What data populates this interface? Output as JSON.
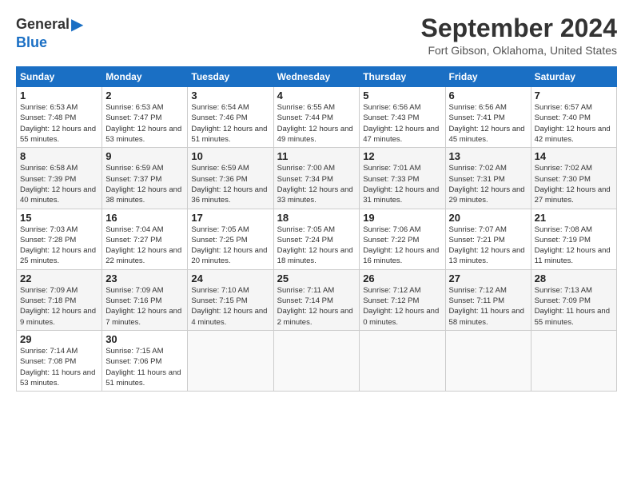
{
  "logo": {
    "general": "General",
    "blue": "Blue"
  },
  "title": "September 2024",
  "location": "Fort Gibson, Oklahoma, United States",
  "days_header": [
    "Sunday",
    "Monday",
    "Tuesday",
    "Wednesday",
    "Thursday",
    "Friday",
    "Saturday"
  ],
  "weeks": [
    [
      {
        "day": "1",
        "sunrise": "6:53 AM",
        "sunset": "7:48 PM",
        "daylight": "12 hours and 55 minutes."
      },
      {
        "day": "2",
        "sunrise": "6:53 AM",
        "sunset": "7:47 PM",
        "daylight": "12 hours and 53 minutes."
      },
      {
        "day": "3",
        "sunrise": "6:54 AM",
        "sunset": "7:46 PM",
        "daylight": "12 hours and 51 minutes."
      },
      {
        "day": "4",
        "sunrise": "6:55 AM",
        "sunset": "7:44 PM",
        "daylight": "12 hours and 49 minutes."
      },
      {
        "day": "5",
        "sunrise": "6:56 AM",
        "sunset": "7:43 PM",
        "daylight": "12 hours and 47 minutes."
      },
      {
        "day": "6",
        "sunrise": "6:56 AM",
        "sunset": "7:41 PM",
        "daylight": "12 hours and 45 minutes."
      },
      {
        "day": "7",
        "sunrise": "6:57 AM",
        "sunset": "7:40 PM",
        "daylight": "12 hours and 42 minutes."
      }
    ],
    [
      {
        "day": "8",
        "sunrise": "6:58 AM",
        "sunset": "7:39 PM",
        "daylight": "12 hours and 40 minutes."
      },
      {
        "day": "9",
        "sunrise": "6:59 AM",
        "sunset": "7:37 PM",
        "daylight": "12 hours and 38 minutes."
      },
      {
        "day": "10",
        "sunrise": "6:59 AM",
        "sunset": "7:36 PM",
        "daylight": "12 hours and 36 minutes."
      },
      {
        "day": "11",
        "sunrise": "7:00 AM",
        "sunset": "7:34 PM",
        "daylight": "12 hours and 33 minutes."
      },
      {
        "day": "12",
        "sunrise": "7:01 AM",
        "sunset": "7:33 PM",
        "daylight": "12 hours and 31 minutes."
      },
      {
        "day": "13",
        "sunrise": "7:02 AM",
        "sunset": "7:31 PM",
        "daylight": "12 hours and 29 minutes."
      },
      {
        "day": "14",
        "sunrise": "7:02 AM",
        "sunset": "7:30 PM",
        "daylight": "12 hours and 27 minutes."
      }
    ],
    [
      {
        "day": "15",
        "sunrise": "7:03 AM",
        "sunset": "7:28 PM",
        "daylight": "12 hours and 25 minutes."
      },
      {
        "day": "16",
        "sunrise": "7:04 AM",
        "sunset": "7:27 PM",
        "daylight": "12 hours and 22 minutes."
      },
      {
        "day": "17",
        "sunrise": "7:05 AM",
        "sunset": "7:25 PM",
        "daylight": "12 hours and 20 minutes."
      },
      {
        "day": "18",
        "sunrise": "7:05 AM",
        "sunset": "7:24 PM",
        "daylight": "12 hours and 18 minutes."
      },
      {
        "day": "19",
        "sunrise": "7:06 AM",
        "sunset": "7:22 PM",
        "daylight": "12 hours and 16 minutes."
      },
      {
        "day": "20",
        "sunrise": "7:07 AM",
        "sunset": "7:21 PM",
        "daylight": "12 hours and 13 minutes."
      },
      {
        "day": "21",
        "sunrise": "7:08 AM",
        "sunset": "7:19 PM",
        "daylight": "12 hours and 11 minutes."
      }
    ],
    [
      {
        "day": "22",
        "sunrise": "7:09 AM",
        "sunset": "7:18 PM",
        "daylight": "12 hours and 9 minutes."
      },
      {
        "day": "23",
        "sunrise": "7:09 AM",
        "sunset": "7:16 PM",
        "daylight": "12 hours and 7 minutes."
      },
      {
        "day": "24",
        "sunrise": "7:10 AM",
        "sunset": "7:15 PM",
        "daylight": "12 hours and 4 minutes."
      },
      {
        "day": "25",
        "sunrise": "7:11 AM",
        "sunset": "7:14 PM",
        "daylight": "12 hours and 2 minutes."
      },
      {
        "day": "26",
        "sunrise": "7:12 AM",
        "sunset": "7:12 PM",
        "daylight": "12 hours and 0 minutes."
      },
      {
        "day": "27",
        "sunrise": "7:12 AM",
        "sunset": "7:11 PM",
        "daylight": "11 hours and 58 minutes."
      },
      {
        "day": "28",
        "sunrise": "7:13 AM",
        "sunset": "7:09 PM",
        "daylight": "11 hours and 55 minutes."
      }
    ],
    [
      {
        "day": "29",
        "sunrise": "7:14 AM",
        "sunset": "7:08 PM",
        "daylight": "11 hours and 53 minutes."
      },
      {
        "day": "30",
        "sunrise": "7:15 AM",
        "sunset": "7:06 PM",
        "daylight": "11 hours and 51 minutes."
      },
      null,
      null,
      null,
      null,
      null
    ]
  ]
}
